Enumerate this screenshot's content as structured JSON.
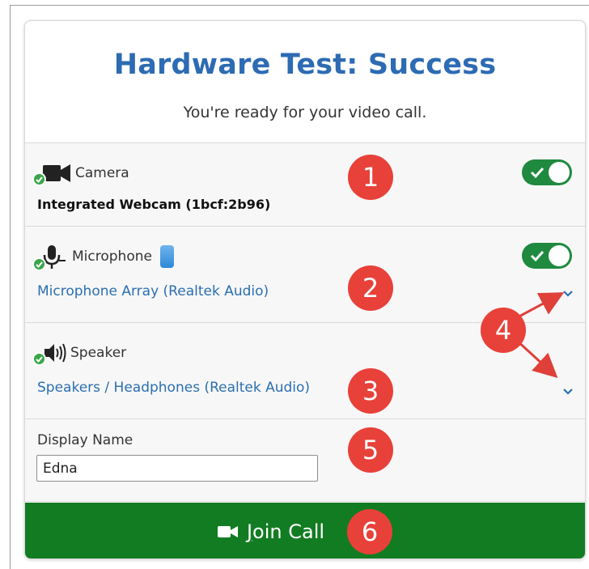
{
  "header": {
    "title": "Hardware Test: Success",
    "subtitle": "You're ready for your video call."
  },
  "camera": {
    "label": "Camera",
    "device": "Integrated Webcam (1bcf:2b96)",
    "icon": "video-camera-icon",
    "enabled": true
  },
  "microphone": {
    "label": "Microphone",
    "device": "Microphone Array (Realtek Audio)",
    "icon": "microphone-icon",
    "enabled": true
  },
  "speaker": {
    "label": "Speaker",
    "device": "Speakers / Headphones (Realtek Audio)",
    "icon": "speaker-icon"
  },
  "display_name": {
    "label": "Display Name",
    "value": "Edna"
  },
  "join": {
    "label_prefix": "J",
    "label_rest": "oin Call",
    "icon": "video-camera-icon"
  },
  "annotations": {
    "badge_1": "1",
    "badge_2": "2",
    "badge_3": "3",
    "badge_4": "4",
    "badge_5": "5",
    "badge_6": "6"
  },
  "colors": {
    "title_blue": "#2d6bb3",
    "link_blue": "#2b6fb0",
    "success_green": "#1f8a3f",
    "join_green": "#127c22",
    "badge_red": "#e8413a",
    "arrow_red": "#e0403a"
  }
}
